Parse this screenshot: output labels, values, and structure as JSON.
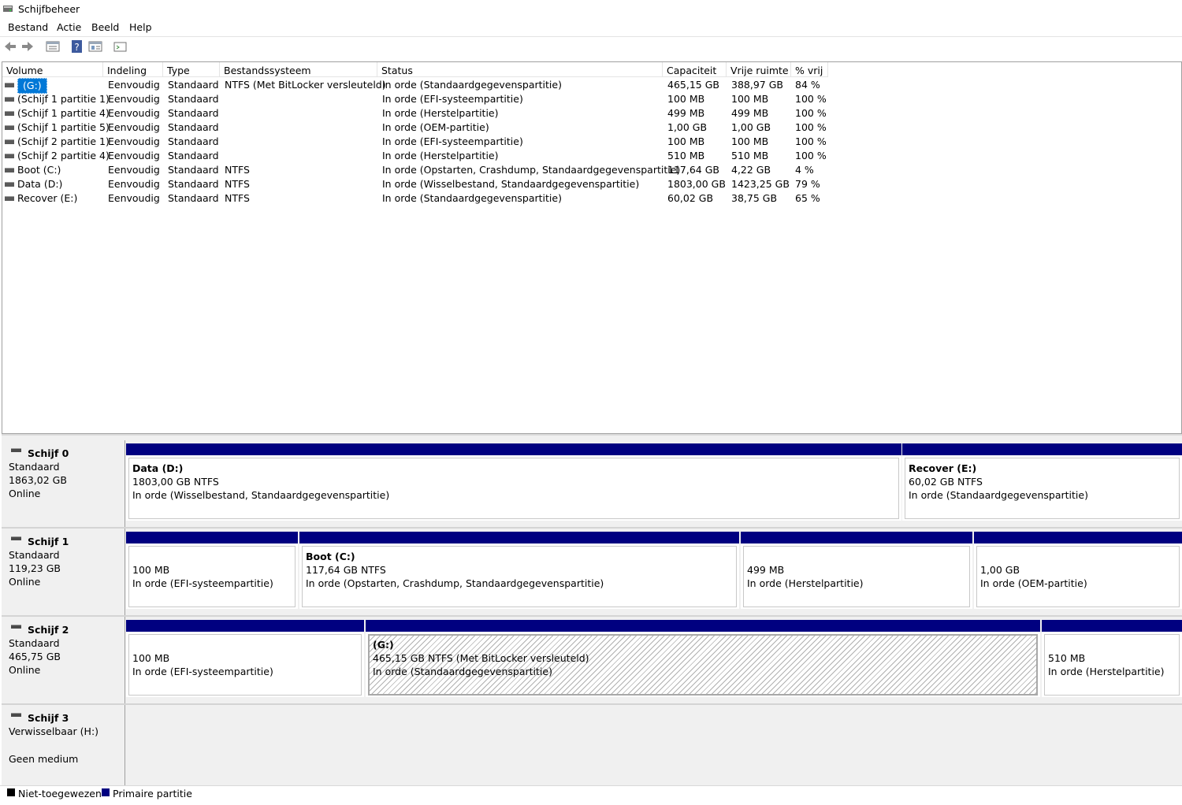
{
  "window": {
    "title": "Schijfbeheer"
  },
  "menu": [
    "Bestand",
    "Actie",
    "Beeld",
    "Help"
  ],
  "toolbar": [
    "back-icon",
    "forward-icon",
    "disk-list-icon",
    "help-icon",
    "properties-icon",
    "console-icon"
  ],
  "columns": [
    "Volume",
    "Indeling",
    "Type",
    "Bestandssysteem",
    "Status",
    "Capaciteit",
    "Vrije ruimte",
    "% vrij"
  ],
  "volumes": [
    {
      "volume": "(G:)",
      "layout": "Eenvoudig",
      "type": "Standaard",
      "fs": "NTFS (Met BitLocker versleuteld)",
      "status": "In orde (Standaardgegevenspartitie)",
      "capacity": "465,15 GB",
      "free": "388,97 GB",
      "pct": "84 %"
    },
    {
      "volume": "(Schijf 1 partitie 1)",
      "layout": "Eenvoudig",
      "type": "Standaard",
      "fs": "",
      "status": "In orde (EFI-systeempartitie)",
      "capacity": "100 MB",
      "free": "100 MB",
      "pct": "100 %"
    },
    {
      "volume": "(Schijf 1 partitie 4)",
      "layout": "Eenvoudig",
      "type": "Standaard",
      "fs": "",
      "status": "In orde (Herstelpartitie)",
      "capacity": "499 MB",
      "free": "499 MB",
      "pct": "100 %"
    },
    {
      "volume": "(Schijf 1 partitie 5)",
      "layout": "Eenvoudig",
      "type": "Standaard",
      "fs": "",
      "status": "In orde (OEM-partitie)",
      "capacity": "1,00 GB",
      "free": "1,00 GB",
      "pct": "100 %"
    },
    {
      "volume": "(Schijf 2 partitie 1)",
      "layout": "Eenvoudig",
      "type": "Standaard",
      "fs": "",
      "status": "In orde (EFI-systeempartitie)",
      "capacity": "100 MB",
      "free": "100 MB",
      "pct": "100 %"
    },
    {
      "volume": "(Schijf 2 partitie 4)",
      "layout": "Eenvoudig",
      "type": "Standaard",
      "fs": "",
      "status": "In orde (Herstelpartitie)",
      "capacity": "510 MB",
      "free": "510 MB",
      "pct": "100 %"
    },
    {
      "volume": "Boot (C:)",
      "layout": "Eenvoudig",
      "type": "Standaard",
      "fs": "NTFS",
      "status": "In orde (Opstarten, Crashdump, Standaardgegevenspartitie)",
      "capacity": "117,64 GB",
      "free": "4,22 GB",
      "pct": "4 %"
    },
    {
      "volume": "Data (D:)",
      "layout": "Eenvoudig",
      "type": "Standaard",
      "fs": "NTFS",
      "status": "In orde (Wisselbestand, Standaardgegevenspartitie)",
      "capacity": "1803,00 GB",
      "free": "1423,25 GB",
      "pct": "79 %"
    },
    {
      "volume": "Recover (E:)",
      "layout": "Eenvoudig",
      "type": "Standaard",
      "fs": "NTFS",
      "status": "In orde (Standaardgegevenspartitie)",
      "capacity": "60,02 GB",
      "free": "38,75 GB",
      "pct": "65 %"
    }
  ],
  "disks": [
    {
      "name": "Schijf 0",
      "kind": "Standaard",
      "size": "1863,02 GB",
      "state": "Online",
      "partitions": [
        {
          "title": "Data  (D:)",
          "line1": "1803,00 GB NTFS",
          "line2": "In orde (Wisselbestand, Standaardgegevenspartitie)"
        },
        {
          "title": "Recover  (E:)",
          "line1": "60,02 GB NTFS",
          "line2": "In orde (Standaardgegevenspartitie)"
        }
      ]
    },
    {
      "name": "Schijf 1",
      "kind": "Standaard",
      "size": "119,23 GB",
      "state": "Online",
      "partitions": [
        {
          "title": "",
          "line1": "100 MB",
          "line2": "In orde (EFI-systeempartitie)"
        },
        {
          "title": "Boot  (C:)",
          "line1": "117,64 GB NTFS",
          "line2": "In orde (Opstarten, Crashdump, Standaardgegevenspartitie)"
        },
        {
          "title": "",
          "line1": "499 MB",
          "line2": "In orde (Herstelpartitie)"
        },
        {
          "title": "",
          "line1": "1,00 GB",
          "line2": "In orde (OEM-partitie)"
        }
      ]
    },
    {
      "name": "Schijf 2",
      "kind": "Standaard",
      "size": "465,75 GB",
      "state": "Online",
      "partitions": [
        {
          "title": "",
          "line1": "100 MB",
          "line2": "In orde (EFI-systeempartitie)"
        },
        {
          "title": "(G:)",
          "line1": "465,15 GB NTFS (Met BitLocker versleuteld)",
          "line2": "In orde (Standaardgegevenspartitie)"
        },
        {
          "title": "",
          "line1": "510 MB",
          "line2": "In orde (Herstelpartitie)"
        }
      ]
    },
    {
      "name": "Schijf 3",
      "kind": "Verwisselbaar (H:)",
      "size": "",
      "state": "Geen medium",
      "partitions": []
    }
  ],
  "legend": [
    {
      "label": "Niet-toegewezen",
      "color": "#000000"
    },
    {
      "label": "Primaire partitie",
      "color": "#000080"
    }
  ]
}
